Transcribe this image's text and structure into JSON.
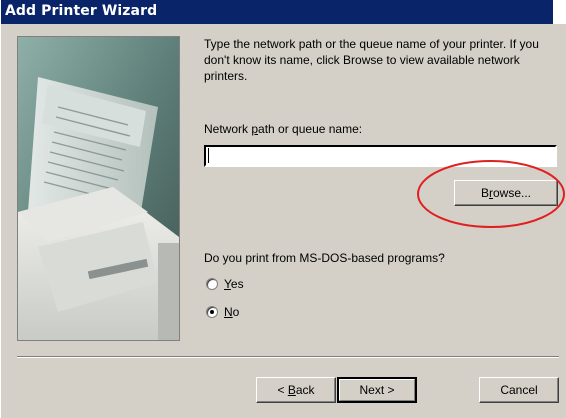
{
  "window": {
    "title": "Add Printer Wizard"
  },
  "picture": {
    "icon": "printer-with-paper-illustration"
  },
  "instruction": "Type the network path or the queue name of your printer. If you don't know its name, click Browse to view available network printers.",
  "path_field": {
    "label_before": "Network ",
    "label_accel": "p",
    "label_after": "ath or queue name:",
    "value": ""
  },
  "browse_button": {
    "label_before": "B",
    "label_accel": "r",
    "label_after": "owse..."
  },
  "annotation": {
    "color": "#e02020"
  },
  "msdos": {
    "question": "Do you print from MS-DOS-based programs?",
    "options": [
      {
        "accel": "Y",
        "rest": "es",
        "checked": false
      },
      {
        "accel": "N",
        "rest": "o",
        "checked": true
      }
    ]
  },
  "nav": {
    "back_prefix": "< ",
    "back_accel": "B",
    "back_rest": "ack",
    "next_label": "Next >",
    "cancel_label": "Cancel"
  },
  "colors": {
    "titlebar": "#0a246a",
    "face": "#d4d0c8"
  }
}
